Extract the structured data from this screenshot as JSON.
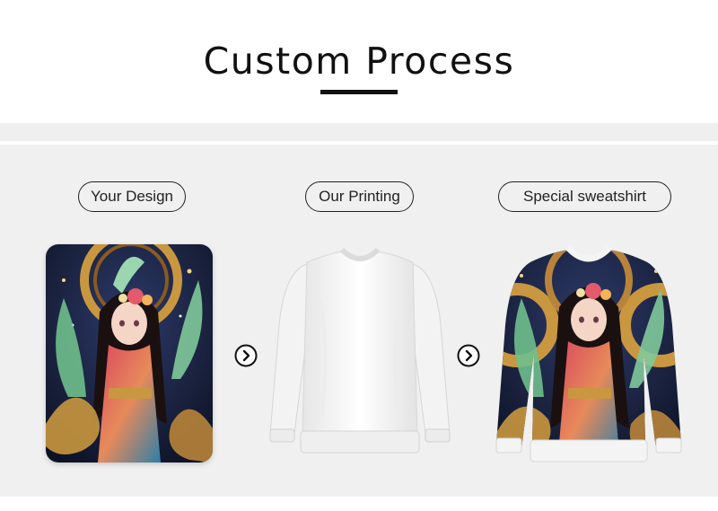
{
  "title": "Custom Process",
  "steps": [
    {
      "label": "Your Design"
    },
    {
      "label": "Our Printing"
    },
    {
      "label": "Special sweatshirt"
    }
  ],
  "icons": {
    "arrow": "chevron-right-circle-icon",
    "design": "anime-girl-artwork",
    "blank": "white-sweatshirt",
    "result": "printed-sweatshirt"
  },
  "colors": {
    "title": "#111111",
    "panel": "#f0f0f0",
    "pill_border": "#222222",
    "art_dark": "#1c2340",
    "art_gold": "#c9973f"
  }
}
